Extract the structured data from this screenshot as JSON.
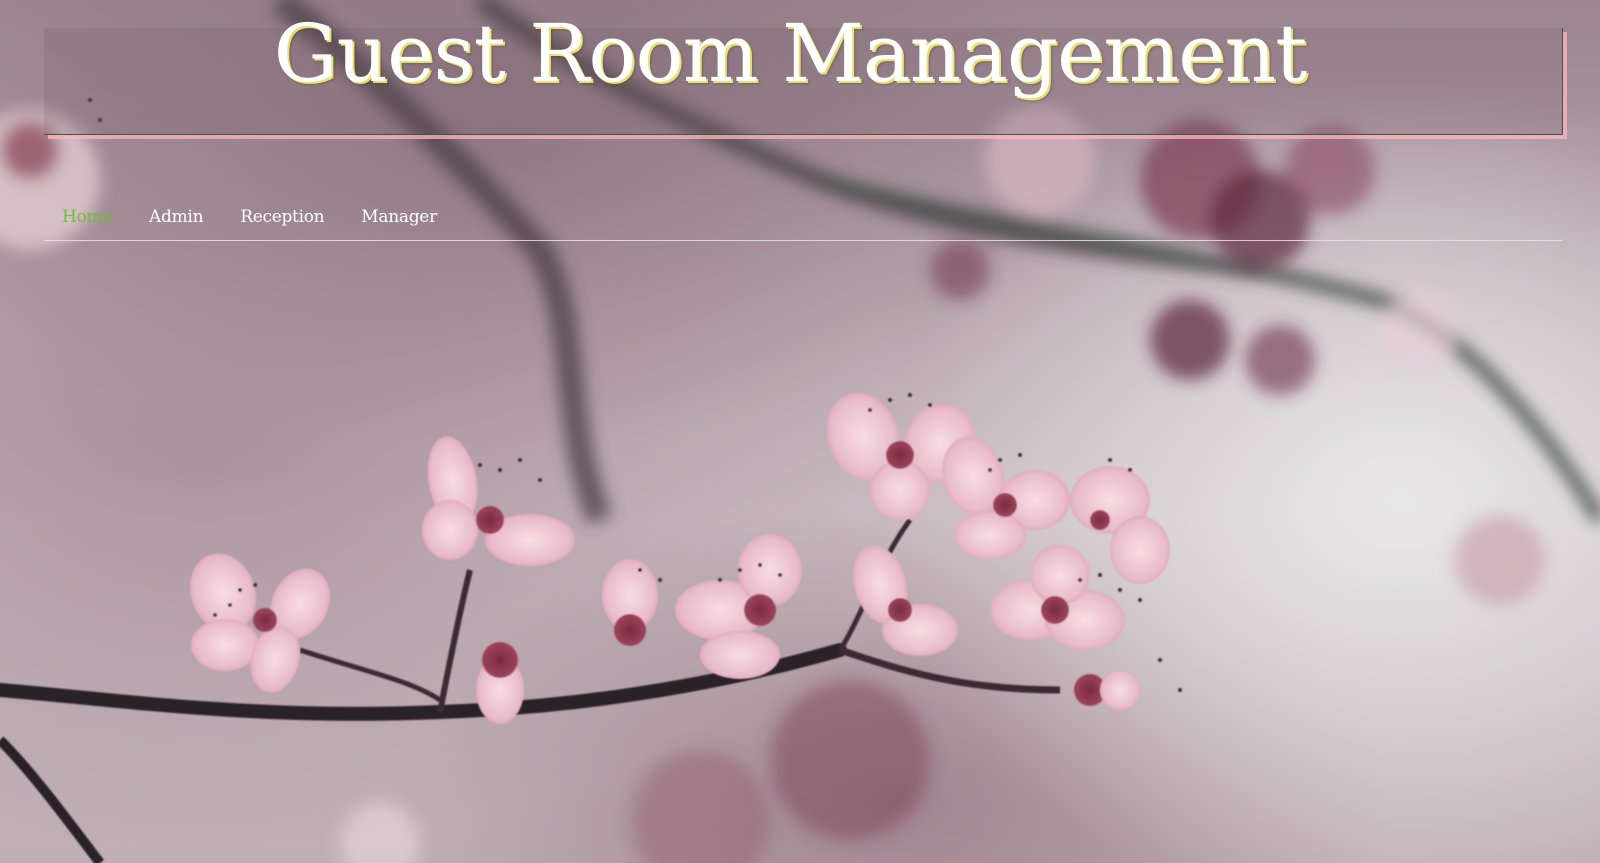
{
  "header": {
    "title": "Guest Room Management"
  },
  "nav": {
    "items": [
      {
        "label": "Home",
        "active": true
      },
      {
        "label": "Admin",
        "active": false
      },
      {
        "label": "Reception",
        "active": false
      },
      {
        "label": "Manager",
        "active": false
      }
    ]
  },
  "colors": {
    "active_link": "#6bbf3a",
    "link": "#ffffff",
    "title_shadow": "#e8e070",
    "header_shadow": "#ffb4c3"
  },
  "background": {
    "subject": "cherry-blossom-branch-photo"
  }
}
